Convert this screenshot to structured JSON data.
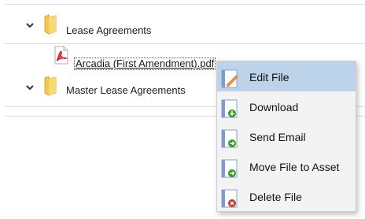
{
  "tree": {
    "folders": [
      {
        "label": "Lease Agreements",
        "expanded": true,
        "icon": "folder-icon"
      },
      {
        "label": "Master Lease Agreements",
        "expanded": true,
        "icon": "folder-icon"
      }
    ],
    "file": {
      "label": "Arcadia (First Amendment).pdf",
      "icon": "pdf-icon"
    }
  },
  "context_menu": {
    "items": [
      {
        "label": "Edit File",
        "icon": "edit-pencil-icon",
        "active": true
      },
      {
        "label": "Download",
        "icon": "download-icon",
        "active": false
      },
      {
        "label": "Send Email",
        "icon": "send-icon",
        "active": false
      },
      {
        "label": "Move File to Asset",
        "icon": "move-icon",
        "active": false
      },
      {
        "label": "Delete File",
        "icon": "delete-icon",
        "active": false
      }
    ]
  },
  "colors": {
    "folder": "#f2c94c",
    "pdf": "#d9232a",
    "menu_highlight": "#bcd3ea",
    "green_badge": "#3a9a2a",
    "red_badge": "#c0392b"
  }
}
